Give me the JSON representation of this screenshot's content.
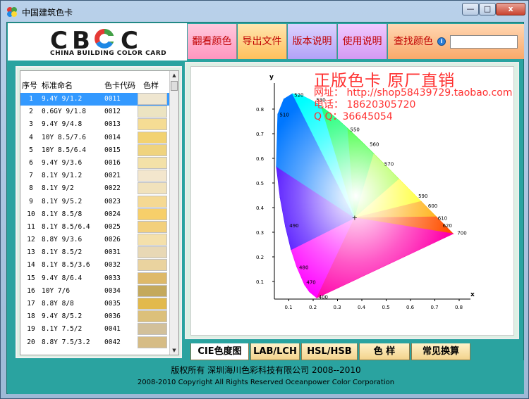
{
  "window": {
    "title": "中国建筑色卡",
    "min_label": "—",
    "max_label": "□",
    "close_label": "x"
  },
  "logo": {
    "letters": [
      "C",
      "B",
      "C",
      "C"
    ],
    "subtitle": "CHINA BUILDING COLOR CARD"
  },
  "menu": {
    "browse": "翻看颜色",
    "export": "导出文件",
    "version": "版本说明",
    "help": "使用说明",
    "find": "查找颜色",
    "find_value": ""
  },
  "list": {
    "headers": [
      "序号",
      "标准命名",
      "色卡代码",
      "色样"
    ],
    "rows": [
      {
        "no": "1",
        "name": "9.4Y 9/1.2",
        "code": "0011",
        "color": "#efe6d0"
      },
      {
        "no": "2",
        "name": "0.6GY 9/1.8",
        "code": "0012",
        "color": "#ece4c2"
      },
      {
        "no": "3",
        "name": "9.4Y 9/4.8",
        "code": "0013",
        "color": "#f5dc94"
      },
      {
        "no": "4",
        "name": "10Y 8.5/7.6",
        "code": "0014",
        "color": "#f2d271"
      },
      {
        "no": "5",
        "name": "10Y 8.5/6.4",
        "code": "0015",
        "color": "#efd37e"
      },
      {
        "no": "6",
        "name": "9.4Y 9/3.6",
        "code": "0016",
        "color": "#f3e1a8"
      },
      {
        "no": "7",
        "name": "8.1Y 9/1.2",
        "code": "0021",
        "color": "#f3e6cd"
      },
      {
        "no": "8",
        "name": "8.1Y 9/2",
        "code": "0022",
        "color": "#f1e2bc"
      },
      {
        "no": "9",
        "name": "8.1Y 9/5.2",
        "code": "0023",
        "color": "#f5d993"
      },
      {
        "no": "10",
        "name": "8.1Y 8.5/8",
        "code": "0024",
        "color": "#f7cf6a"
      },
      {
        "no": "11",
        "name": "8.1Y 8.5/6.4",
        "code": "0025",
        "color": "#f3d07c"
      },
      {
        "no": "12",
        "name": "8.8Y 9/3.6",
        "code": "0026",
        "color": "#f4e0ab"
      },
      {
        "no": "13",
        "name": "8.1Y 8.5/2",
        "code": "0031",
        "color": "#e8d8b5"
      },
      {
        "no": "14",
        "name": "8.1Y 8.5/3.6",
        "code": "0032",
        "color": "#ead39f"
      },
      {
        "no": "15",
        "name": "9.4Y 8/6.4",
        "code": "0033",
        "color": "#deb969"
      },
      {
        "no": "16",
        "name": "10Y 7/6",
        "code": "0034",
        "color": "#c4a95c"
      },
      {
        "no": "17",
        "name": "8.8Y 8/8",
        "code": "0035",
        "color": "#e2b94c"
      },
      {
        "no": "18",
        "name": "9.4Y 8/5.2",
        "code": "0036",
        "color": "#dcc07a"
      },
      {
        "no": "19",
        "name": "8.1Y 7.5/2",
        "code": "0041",
        "color": "#d2c09a"
      },
      {
        "no": "20",
        "name": "8.8Y 7.5/3.2",
        "code": "0042",
        "color": "#d6bc85"
      }
    ],
    "selected_index": 0,
    "scroll_up": "▲",
    "scroll_down": "▼"
  },
  "promo": {
    "title": "正版色卡 原厂直销",
    "website": "网址： http://shop58439729.taobao.com",
    "phone": "电话： 18620305720",
    "qq": "Q  Q：36645054"
  },
  "chart_data": {
    "type": "scatter",
    "title": "",
    "xlabel": "x",
    "ylabel": "y",
    "xlim": [
      0,
      0.8
    ],
    "ylim": [
      0,
      0.9
    ],
    "x_ticks": [
      "0.1",
      "0.2",
      "0.3",
      "0.4",
      "0.5",
      "0.6",
      "0.7",
      "0.8"
    ],
    "y_ticks": [
      "0.1",
      "0.2",
      "0.3",
      "0.4",
      "0.5",
      "0.6",
      "0.7",
      "0.8"
    ],
    "wavelength_labels": [
      {
        "label": "400",
        "x": 0.17,
        "y": 0.01
      },
      {
        "label": "470",
        "x": 0.12,
        "y": 0.07
      },
      {
        "label": "480",
        "x": 0.09,
        "y": 0.13
      },
      {
        "label": "490",
        "x": 0.05,
        "y": 0.3
      },
      {
        "label": "510",
        "x": 0.01,
        "y": 0.75
      },
      {
        "label": "520",
        "x": 0.07,
        "y": 0.83
      },
      {
        "label": "530",
        "x": 0.16,
        "y": 0.81
      },
      {
        "label": "550",
        "x": 0.3,
        "y": 0.69
      },
      {
        "label": "560",
        "x": 0.38,
        "y": 0.63
      },
      {
        "label": "570",
        "x": 0.44,
        "y": 0.55
      },
      {
        "label": "590",
        "x": 0.58,
        "y": 0.42
      },
      {
        "label": "600",
        "x": 0.62,
        "y": 0.38
      },
      {
        "label": "610",
        "x": 0.66,
        "y": 0.33
      },
      {
        "label": "620",
        "x": 0.68,
        "y": 0.3
      },
      {
        "label": "700",
        "x": 0.74,
        "y": 0.27
      }
    ],
    "white_point": {
      "x": 0.33,
      "y": 0.33
    }
  },
  "tabs": [
    "CIE色度图",
    "LAB/LCH",
    "HSL/HSB",
    "色    样",
    "常见换算"
  ],
  "active_tab": 0,
  "footer": {
    "line1": "版权所有  深圳海川色彩科技有限公司  2008--2010",
    "line2": "2008-2010   Copyright All Rights Reserved Oceanpower Color Corporation"
  },
  "colors": {
    "client_bg": "#2aa3a0",
    "promo_red": "#ff3030",
    "selection": "#3399ff"
  }
}
